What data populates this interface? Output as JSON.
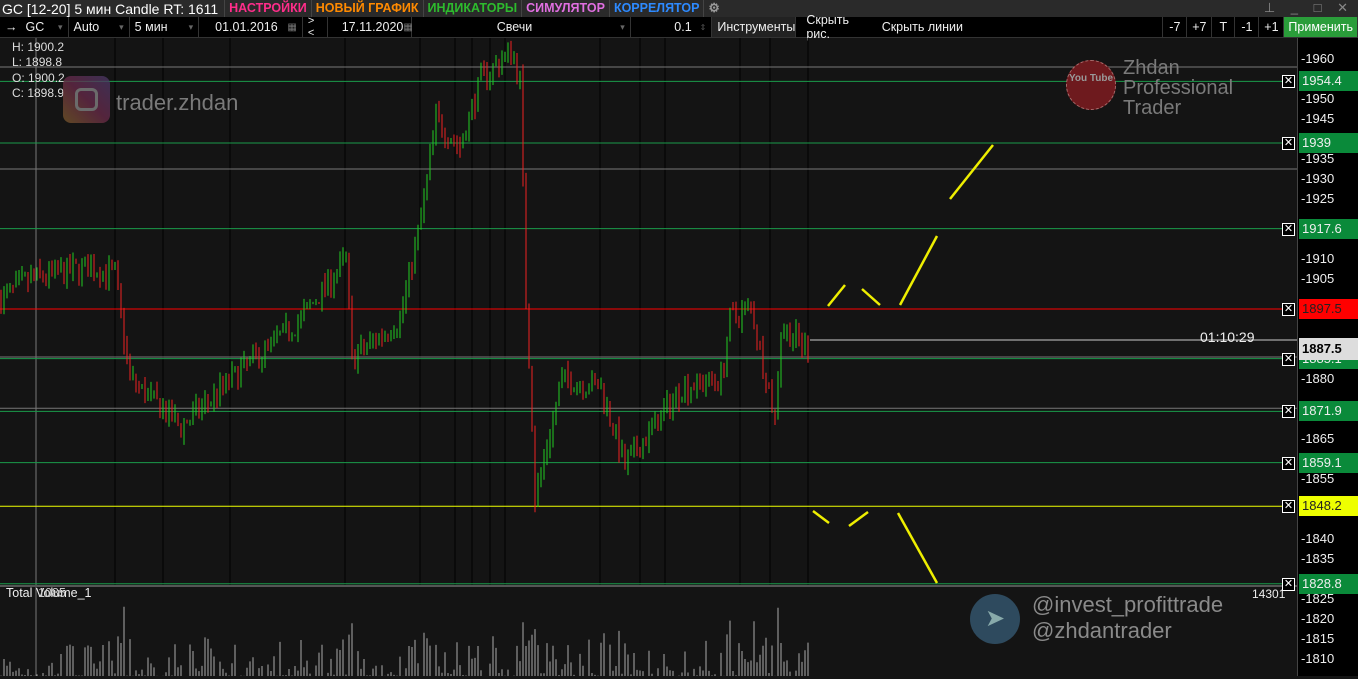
{
  "titlebar": {
    "title": "GC [12-20] 5 мин Candle RT: 1611",
    "menu": [
      {
        "label": "НАСТРОЙКИ",
        "color": "#ff2d8a"
      },
      {
        "label": "НОВЫЙ ГРАФИК",
        "color": "#ff8a00"
      },
      {
        "label": "ИНДИКАТОРЫ",
        "color": "#2dbb2d"
      },
      {
        "label": "СИМУЛЯТОР",
        "color": "#e06fe0"
      },
      {
        "label": "КОРРЕЛЯТОР",
        "color": "#2d8aff"
      }
    ],
    "window_controls": "⊥ _ □ ✕"
  },
  "toolbar": {
    "symbol": "GC",
    "scale": "Auto",
    "timeframe": "5 мин",
    "date_from": "01.01.2016",
    "nav": "> <",
    "date_to": "17.11.2020",
    "chart_type": "Свечи",
    "step": "0.1",
    "instruments": "Инструменты",
    "hide_drawings": "Скрыть рис.",
    "hide_lines": "Скрыть линии",
    "minus7": "-7",
    "plus7": "+7",
    "t": "T",
    "minus1": "-1",
    "plus1": "+1",
    "apply": "Применить"
  },
  "ohlc": {
    "h": "H: 1900.2",
    "l": "L: 1898.8",
    "o": "O: 1900.2",
    "c": "C: 1898.9"
  },
  "watermarks": {
    "instagram": "trader.zhdan",
    "youtube_l1": "Zhdan",
    "youtube_l2": "Professional",
    "youtube_l3": "Trader",
    "telegram1": "@invest_profittrade",
    "telegram2": "@zhdantrader",
    "yt_logo": "You Tube"
  },
  "timer": "01:10:29",
  "volume": {
    "label": "Total Volume_1",
    "overlay": "1085",
    "max": "14301"
  },
  "chart_data": {
    "type": "candlestick",
    "symbol": "GC",
    "timeframe": "5 мин",
    "ylim": [
      1805,
      1965
    ],
    "y_ticks": [
      1960,
      1950,
      1945,
      1935,
      1930,
      1925,
      1910,
      1905,
      1880,
      1865,
      1855,
      1840,
      1835,
      1825,
      1820,
      1815,
      1810
    ],
    "price_path": [
      [
        0,
        1900
      ],
      [
        10,
        1905
      ],
      [
        30,
        1908
      ],
      [
        38,
        1906
      ],
      [
        43,
        1880
      ],
      [
        60,
        1868
      ],
      [
        77,
        1880
      ],
      [
        100,
        1895
      ],
      [
        115,
        1910
      ],
      [
        117,
        1885
      ],
      [
        133,
        1895
      ],
      [
        140,
        1920
      ],
      [
        145,
        1945
      ],
      [
        153,
        1938
      ],
      [
        160,
        1955
      ],
      [
        170,
        1962
      ],
      [
        173,
        1955
      ],
      [
        175,
        1900
      ],
      [
        177,
        1870
      ],
      [
        178,
        1850
      ],
      [
        187,
        1880
      ],
      [
        200,
        1878
      ],
      [
        208,
        1858
      ],
      [
        227,
        1878
      ],
      [
        240,
        1880
      ],
      [
        243,
        1895
      ],
      [
        250,
        1898
      ],
      [
        258,
        1870
      ],
      [
        260,
        1893
      ],
      [
        269,
        1887.5
      ]
    ],
    "last_price": "1887.5",
    "levels": [
      {
        "price": "1954.4",
        "color": "#0a8a3a"
      },
      {
        "price": "1939",
        "color": "#0a8a3a"
      },
      {
        "price": "1917.6",
        "color": "#0a8a3a"
      },
      {
        "price": "1897.5",
        "color": "#ff0000"
      },
      {
        "price": "1885.1",
        "color": "#0a8a3a"
      },
      {
        "price": "1871.9",
        "color": "#0a8a3a"
      },
      {
        "price": "1859.1",
        "color": "#0a8a3a"
      },
      {
        "price": "1848.2",
        "color": "#eeff00"
      },
      {
        "price": "1828.8",
        "color": "#0a8a3a"
      }
    ],
    "gray_levels": [
      1958,
      1932.5,
      1885.5,
      1872.7
    ]
  }
}
